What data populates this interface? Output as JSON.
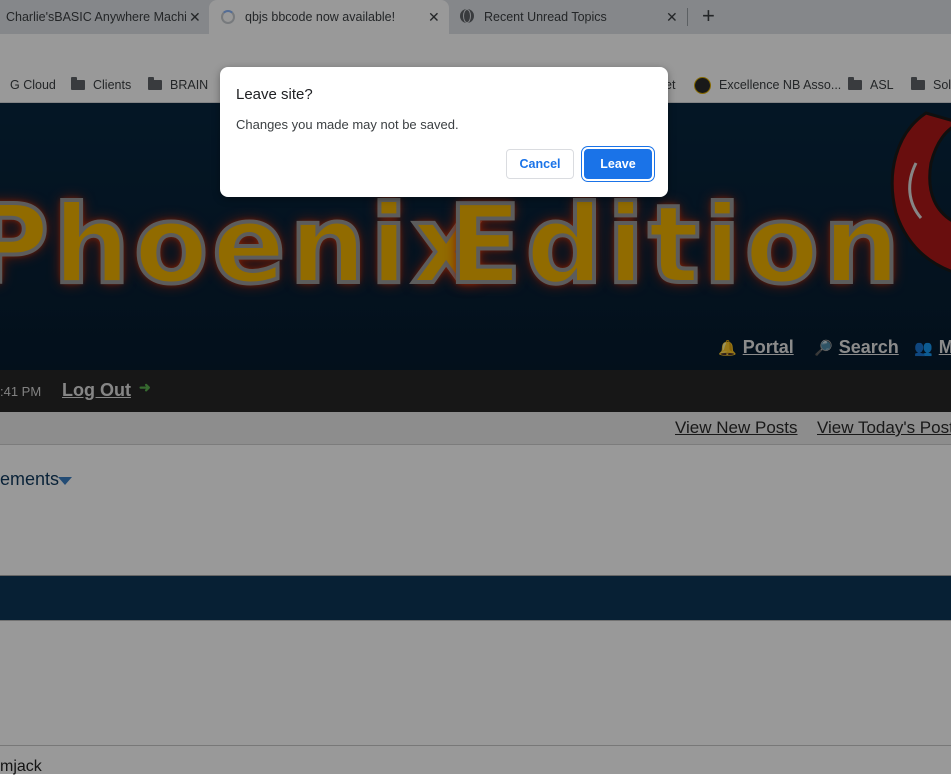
{
  "tabs": [
    {
      "title": "Charlie'sBASIC Anywhere Machine",
      "state": "inactive"
    },
    {
      "title": "qbjs bbcode now available!",
      "state": "active-loading"
    },
    {
      "title": "Recent Unread Topics",
      "state": "inactive"
    }
  ],
  "new_tab": "+",
  "close_glyph": "✕",
  "bookmarks": [
    {
      "label": "G Cloud",
      "icon": "folder-icon"
    },
    {
      "label": "Clients",
      "icon": "folder-icon"
    },
    {
      "label": "BRAIN",
      "icon": "folder-icon"
    },
    {
      "label": "et",
      "icon": ""
    },
    {
      "label": "Excellence NB Asso...",
      "icon": "site-icon"
    },
    {
      "label": "ASL",
      "icon": "folder-icon"
    },
    {
      "label": "Sol",
      "icon": "folder-icon"
    }
  ],
  "banner": {
    "logo_word_1": "Phoenix",
    "logo_word_2": "Edition",
    "nav": {
      "portal": "Portal",
      "search": "Search",
      "more": "M"
    }
  },
  "userbar": {
    "time": ":41 PM",
    "logout": "Log Out"
  },
  "links": {
    "new_posts": "View New Posts",
    "todays_posts": "View Today's Posts"
  },
  "announcements": {
    "label": "ements"
  },
  "post_user": "mjack",
  "dialog": {
    "title": "Leave site?",
    "message": "Changes you made may not be saved.",
    "cancel": "Cancel",
    "leave": "Leave"
  },
  "colors": {
    "accent": "#1a73e8",
    "banner_bg": "#08263f",
    "fire": "#f2b300"
  }
}
